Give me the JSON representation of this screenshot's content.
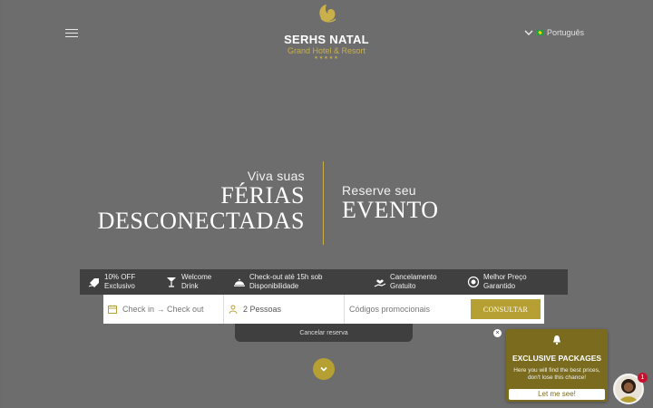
{
  "header": {
    "menu_icon": "hamburger-icon",
    "logo": {
      "name": "SERHS NATAL",
      "subtitle": "Grand Hotel & Resort",
      "stars": "★★★★★"
    },
    "language": {
      "label": "Português",
      "icon": "brazil-flag-icon"
    }
  },
  "hero": {
    "left": {
      "line1": "Viva suas",
      "line2": "FÉRIAS",
      "line3": "DESCONECTADAS"
    },
    "right": {
      "line1": "Reserve seu",
      "line2": "EVENTO"
    }
  },
  "benefits": [
    {
      "line1": "10% OFF",
      "line2": "Exclusivo",
      "icon": "discount-tag-icon"
    },
    {
      "line1": "Welcome",
      "line2": "Drink",
      "icon": "cocktail-icon"
    },
    {
      "line1": "Check-out até 15h sob",
      "line2": "Disponibilidade",
      "icon": "cloche-icon"
    },
    {
      "line1": "Cancelamento",
      "line2": "Gratuito",
      "icon": "hand-heart-icon"
    },
    {
      "line1": "Melhor Preço",
      "line2": "Garantido",
      "icon": "price-badge-icon"
    }
  ],
  "booking": {
    "dates": "Check in → Check out",
    "guests": "2 Pessoas",
    "promo_placeholder": "Códigos promocionais",
    "submit": "CONSULTAR",
    "cancel": "Cancelar reserva"
  },
  "popup": {
    "title": "EXCLUSIVE PACKAGES",
    "description": "Here you will find the best prices, don't lose this chance!",
    "cta": "Let me see!",
    "close": "×",
    "badge": "1"
  },
  "colors": {
    "gold": "#b7a033",
    "overlay": "#6d6d6d",
    "bar": "#404040",
    "popup": "#7a6b1e"
  }
}
